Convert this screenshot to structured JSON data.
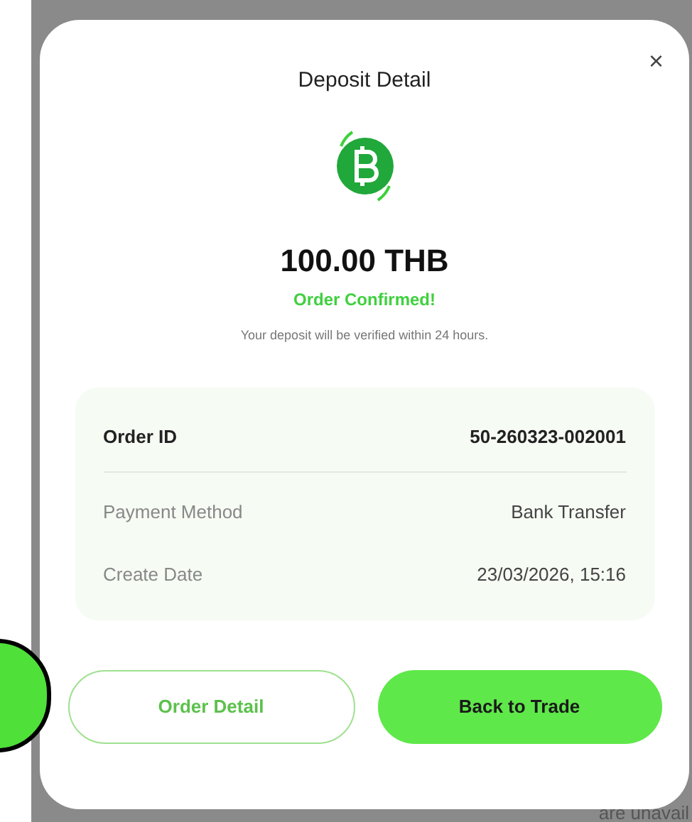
{
  "dialog": {
    "title": "Deposit Detail",
    "close": "×",
    "amount": "100.00 THB",
    "status": "Order Confirmed!",
    "note": "Your deposit will be verified within 24 hours.",
    "details": [
      {
        "label": "Order ID",
        "value": "50-260323-002001",
        "kind": "primary"
      },
      {
        "label": "Payment Method",
        "value": "Bank Transfer",
        "kind": "secondary"
      },
      {
        "label": "Create Date",
        "value": "23/03/2026, 15:16",
        "kind": "secondary"
      }
    ],
    "buttons": [
      {
        "label": "Order Detail",
        "kind": "outline"
      },
      {
        "label": "Back to Trade",
        "kind": "filled"
      }
    ]
  },
  "background_text": "are unavail"
}
